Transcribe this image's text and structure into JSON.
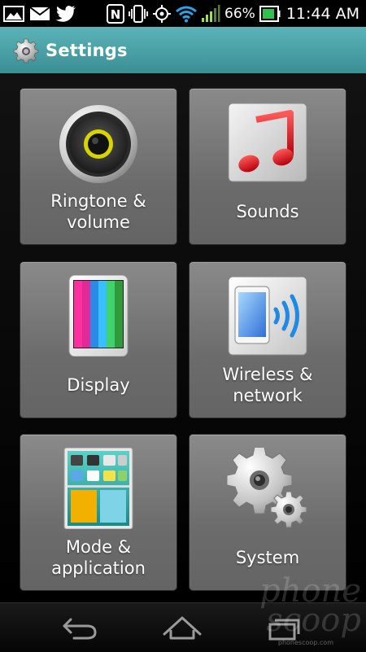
{
  "status_bar": {
    "battery_percent": "66%",
    "time": "11:44 AM",
    "nfc_label": "N",
    "left_icons": [
      "gallery-icon",
      "mail-icon",
      "twitter-icon"
    ],
    "right_icons": [
      "nfc-icon",
      "vibrate-icon",
      "gps-icon",
      "wifi-icon",
      "signal-icon",
      "battery-icon"
    ]
  },
  "title_bar": {
    "title": "Settings",
    "icon": "gear-icon",
    "color": "#4a9fa5"
  },
  "tiles": [
    {
      "label": "Ringtone &\nvolume",
      "icon": "speaker-icon"
    },
    {
      "label": "Sounds",
      "icon": "music-note-icon"
    },
    {
      "label": "Display",
      "icon": "display-phone-icon"
    },
    {
      "label": "Wireless &\nnetwork",
      "icon": "wireless-phone-icon"
    },
    {
      "label": "Mode &\napplication",
      "icon": "apps-grid-icon"
    },
    {
      "label": "System",
      "icon": "system-gears-icon"
    }
  ],
  "nav_bar": {
    "buttons": [
      "back-icon",
      "home-icon",
      "recent-apps-icon"
    ]
  },
  "watermark": {
    "logo": "phone scoop",
    "url": "phonescoop.com"
  }
}
